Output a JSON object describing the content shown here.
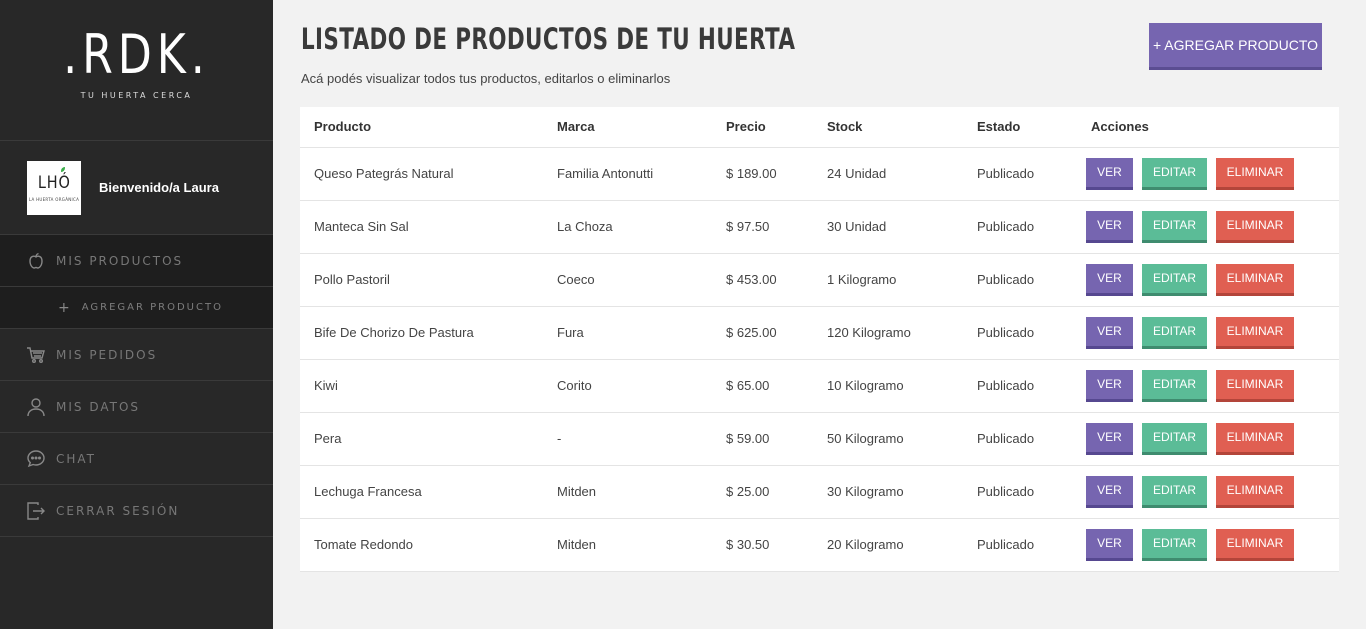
{
  "brand": {
    "logo": ".RDK.",
    "tagline": "TU HUERTA CERCA"
  },
  "user": {
    "avatar_text": "LHÓ",
    "avatar_sub": "LA HUERTA ORGÁNICA",
    "welcome": "Bienvenido/a Laura"
  },
  "nav": {
    "productos": "MIS PRODUCTOS",
    "agregar": "AGREGAR PRODUCTO",
    "pedidos": "MIS PEDIDOS",
    "datos": "MIS DATOS",
    "chat": "CHAT",
    "cerrar": "CERRAR SESIÓN"
  },
  "header": {
    "title": "LISTADO DE PRODUCTOS DE TU HUERTA",
    "subtitle": "Acá podés visualizar todos tus productos, editarlos o eliminarlos",
    "add_button": "+ AGREGAR PRODUCTO"
  },
  "table": {
    "columns": [
      "Producto",
      "Marca",
      "Precio",
      "Stock",
      "Estado",
      "Acciones"
    ],
    "rows": [
      [
        "Queso Pategrás Natural",
        "Familia Antonutti",
        "$ 189.00",
        "24 Unidad",
        "Publicado"
      ],
      [
        "Manteca Sin Sal",
        "La Choza",
        "$ 97.50",
        "30 Unidad",
        "Publicado"
      ],
      [
        "Pollo Pastoril",
        "Coeco",
        "$ 453.00",
        "1 Kilogramo",
        "Publicado"
      ],
      [
        "Bife De Chorizo De Pastura",
        "Fura",
        "$ 625.00",
        "120 Kilogramo",
        "Publicado"
      ],
      [
        "Kiwi",
        "Corito",
        "$ 65.00",
        "10 Kilogramo",
        "Publicado"
      ],
      [
        "Pera",
        "-",
        "$ 59.00",
        "50 Kilogramo",
        "Publicado"
      ],
      [
        "Lechuga Francesa",
        "Mitden",
        "$ 25.00",
        "30 Kilogramo",
        "Publicado"
      ],
      [
        "Tomate Redondo",
        "Mitden",
        "$ 30.50",
        "20 Kilogramo",
        "Publicado"
      ]
    ],
    "btn_ver": "VER",
    "btn_edit": "EDITAR",
    "btn_del": "ELIMINAR"
  }
}
